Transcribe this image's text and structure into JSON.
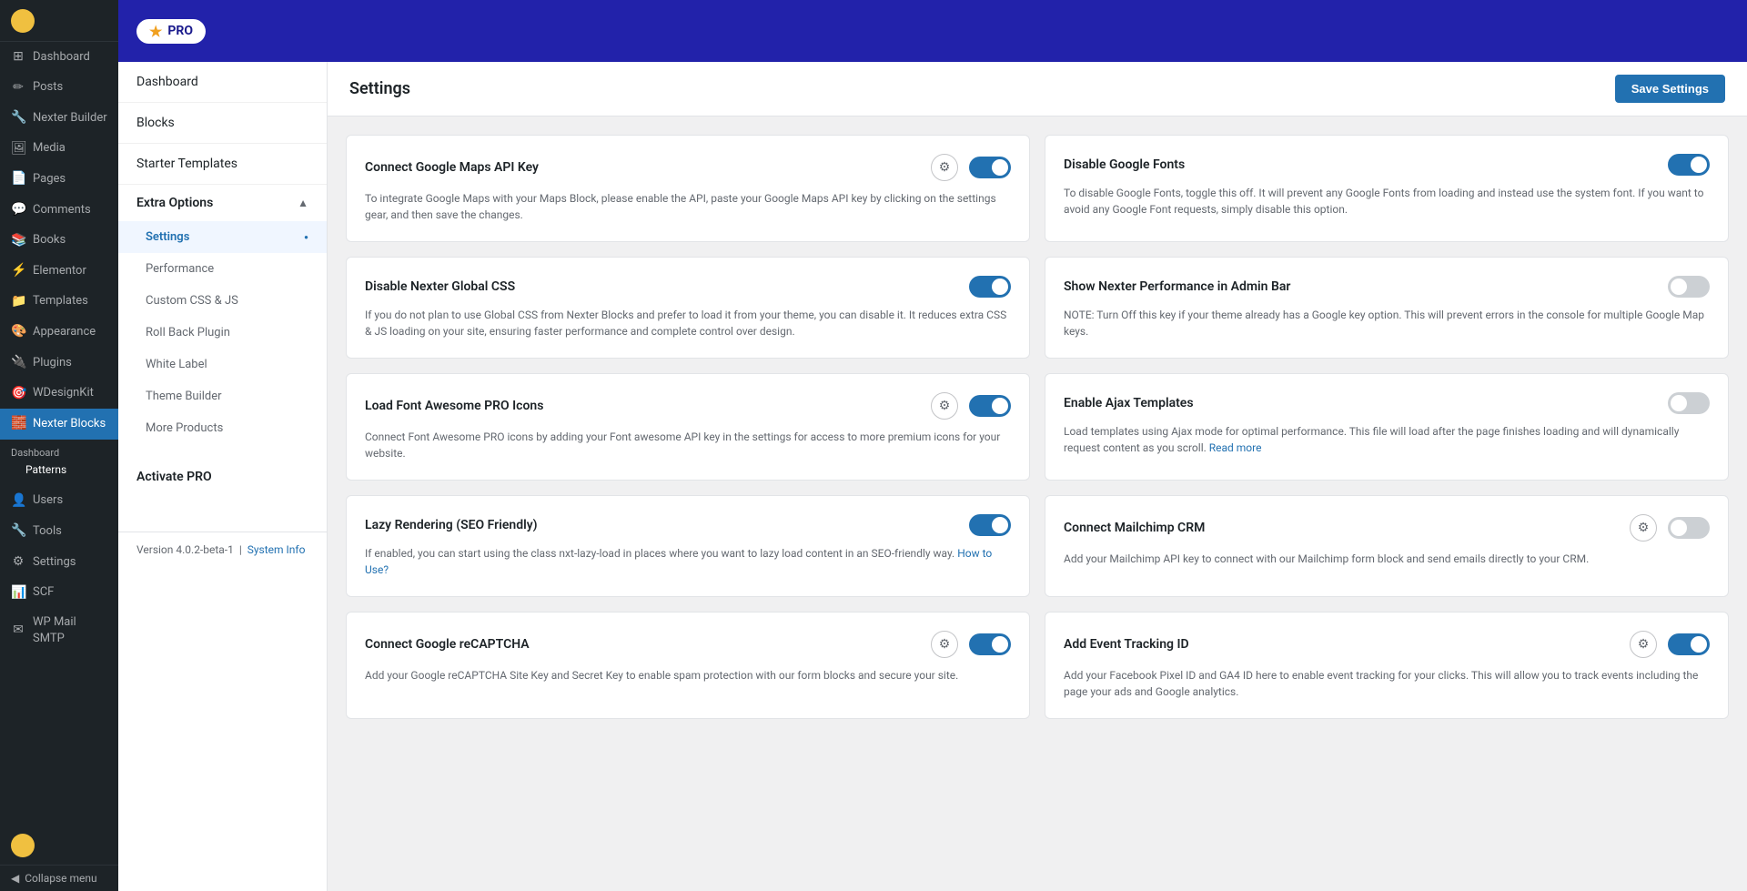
{
  "sidebar": {
    "items": [
      {
        "id": "dashboard",
        "label": "Dashboard",
        "icon": "⊞"
      },
      {
        "id": "posts",
        "label": "Posts",
        "icon": "📝"
      },
      {
        "id": "nexter-builder",
        "label": "Nexter Builder",
        "icon": "🔧"
      },
      {
        "id": "media",
        "label": "Media",
        "icon": "🖼"
      },
      {
        "id": "pages",
        "label": "Pages",
        "icon": "📄"
      },
      {
        "id": "comments",
        "label": "Comments",
        "icon": "💬"
      },
      {
        "id": "books",
        "label": "Books",
        "icon": "📚"
      },
      {
        "id": "elementor",
        "label": "Elementor",
        "icon": "⚡"
      },
      {
        "id": "templates",
        "label": "Templates",
        "icon": "📁"
      },
      {
        "id": "appearance",
        "label": "Appearance",
        "icon": "🎨"
      },
      {
        "id": "plugins",
        "label": "Plugins",
        "icon": "🔌"
      },
      {
        "id": "wdesignkit",
        "label": "WDesignKit",
        "icon": "🎯"
      },
      {
        "id": "nexter-blocks",
        "label": "Nexter Blocks",
        "icon": "🧱"
      }
    ],
    "sub_items": [
      {
        "id": "nb-dashboard",
        "label": "Dashboard"
      },
      {
        "id": "nb-patterns",
        "label": "Patterns"
      }
    ],
    "bottom_items": [
      {
        "id": "users",
        "label": "Users",
        "icon": "👤"
      },
      {
        "id": "tools",
        "label": "Tools",
        "icon": "🔧"
      },
      {
        "id": "settings",
        "label": "Settings",
        "icon": "⚙"
      },
      {
        "id": "scf",
        "label": "SCF",
        "icon": "📊"
      },
      {
        "id": "wp-mail-smtp",
        "label": "WP Mail SMTP",
        "icon": "✉"
      }
    ],
    "collapse_label": "Collapse menu"
  },
  "top_bar": {
    "pro_badge": "PRO",
    "star_icon": "★"
  },
  "left_panel": {
    "items": [
      {
        "id": "dashboard",
        "label": "Dashboard"
      },
      {
        "id": "blocks",
        "label": "Blocks"
      },
      {
        "id": "starter-templates",
        "label": "Starter Templates"
      }
    ],
    "extra_options": {
      "label": "Extra Options",
      "sub_items": [
        {
          "id": "settings",
          "label": "Settings",
          "active": true
        },
        {
          "id": "performance",
          "label": "Performance"
        },
        {
          "id": "custom-css-js",
          "label": "Custom CSS & JS"
        },
        {
          "id": "roll-back-plugin",
          "label": "Roll Back Plugin"
        },
        {
          "id": "white-label",
          "label": "White Label"
        },
        {
          "id": "theme-builder",
          "label": "Theme Builder"
        },
        {
          "id": "more-products",
          "label": "More Products"
        }
      ]
    },
    "activate_pro": "Activate PRO",
    "footer": {
      "version": "Version 4.0.2-beta-1",
      "separator": "|",
      "system_info": "System Info"
    }
  },
  "settings": {
    "title": "Settings",
    "save_button": "Save Settings",
    "cards": [
      {
        "id": "google-maps-api",
        "title": "Connect Google Maps API Key",
        "description": "To integrate Google Maps with your Maps Block, please enable the API, paste your Google Maps API key by clicking on the settings gear, and then save the changes.",
        "has_gear": true,
        "toggle_on": true
      },
      {
        "id": "disable-google-fonts",
        "title": "Disable Google Fonts",
        "description": "To disable Google Fonts, toggle this off. It will prevent any Google Fonts from loading and instead use the system font. If you want to avoid any Google Font requests, simply disable this option.",
        "has_gear": false,
        "toggle_on": true
      },
      {
        "id": "disable-nexter-css",
        "title": "Disable Nexter Global CSS",
        "description": "If you do not plan to use Global CSS from Nexter Blocks and prefer to load it from your theme, you can disable it. It reduces extra CSS & JS loading on your site, ensuring faster performance and complete control over design.",
        "has_gear": false,
        "toggle_on": true
      },
      {
        "id": "nexter-performance-admin",
        "title": "Show Nexter Performance in Admin Bar",
        "description": "NOTE: Turn Off this key if your theme already has a Google key option. This will prevent errors in the console for multiple Google Map keys.",
        "has_gear": false,
        "toggle_on": false
      },
      {
        "id": "load-font-awesome",
        "title": "Load Font Awesome PRO Icons",
        "description": "Connect Font Awesome PRO icons by adding your Font awesome API key in the settings for access to more premium icons for your website.",
        "has_gear": true,
        "toggle_on": true
      },
      {
        "id": "enable-ajax-templates",
        "title": "Enable Ajax Templates",
        "description": "Load templates using Ajax mode for optimal performance. This file will load after the page finishes loading and will dynamically request content as you scroll.",
        "has_gear": false,
        "toggle_on": false,
        "read_more": "Read more"
      },
      {
        "id": "lazy-rendering",
        "title": "Lazy Rendering (SEO Friendly)",
        "description": "If enabled, you can start using the class nxt-lazy-load in places where you want to lazy load content in an SEO-friendly way.",
        "has_gear": false,
        "toggle_on": true,
        "how_to": "How to Use?"
      },
      {
        "id": "connect-mailchimp",
        "title": "Connect Mailchimp CRM",
        "description": "Add your Mailchimp API key to connect with our Mailchimp form block and send emails directly to your CRM.",
        "has_gear": true,
        "toggle_on": false
      },
      {
        "id": "connect-recaptcha",
        "title": "Connect Google reCAPTCHA",
        "description": "Add your Google reCAPTCHA Site Key and Secret Key to enable spam protection with our form blocks and secure your site.",
        "has_gear": true,
        "toggle_on": true
      },
      {
        "id": "event-tracking",
        "title": "Add Event Tracking ID",
        "description": "Add your Facebook Pixel ID and GA4 ID here to enable event tracking for your clicks. This will allow you to track events including the page your ads and Google analytics.",
        "has_gear": true,
        "toggle_on": true
      }
    ]
  }
}
